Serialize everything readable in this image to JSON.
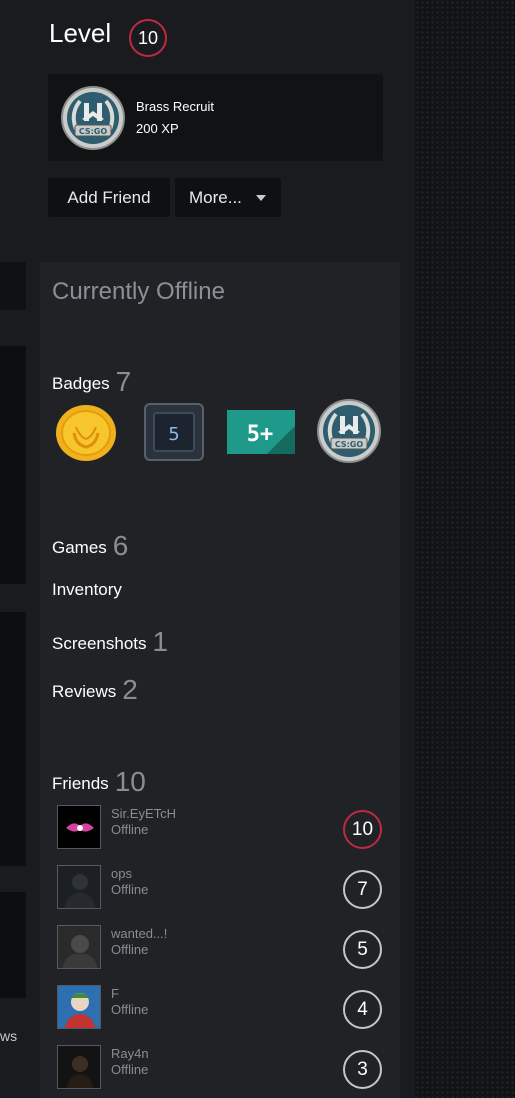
{
  "header": {
    "level_label": "Level",
    "level_value": "10"
  },
  "xp": {
    "badge_name": "Brass Recruit",
    "xp_text": "200 XP"
  },
  "buttons": {
    "add_friend": "Add Friend",
    "more": "More..."
  },
  "side_text": "ws",
  "profile": {
    "status": "Currently Offline"
  },
  "sections": {
    "badges": {
      "label": "Badges",
      "count": "7"
    },
    "games": {
      "label": "Games",
      "count": "6"
    },
    "inventory": {
      "label": "Inventory"
    },
    "screenshots": {
      "label": "Screenshots",
      "count": "1"
    },
    "reviews": {
      "label": "Reviews",
      "count": "2"
    },
    "friends": {
      "label": "Friends",
      "count": "10"
    }
  },
  "badge_icons": {
    "medal": "gold-medal-icon",
    "years": "5",
    "plus": "5+",
    "cs": "CSGO"
  },
  "friends": [
    {
      "name": "Sir.EyETcH",
      "status": "Offline",
      "level": "10"
    },
    {
      "name": "ops",
      "status": "Offline",
      "level": "7"
    },
    {
      "name": "wanted...!",
      "status": "Offline",
      "level": "5"
    },
    {
      "name": "F",
      "status": "Offline",
      "level": "4"
    },
    {
      "name": "Ray4n",
      "status": "Offline",
      "level": "3"
    }
  ],
  "colors": {
    "level_ring_accent": "#c02942",
    "panel_bg": "#202226",
    "page_bg": "#191b1e"
  }
}
